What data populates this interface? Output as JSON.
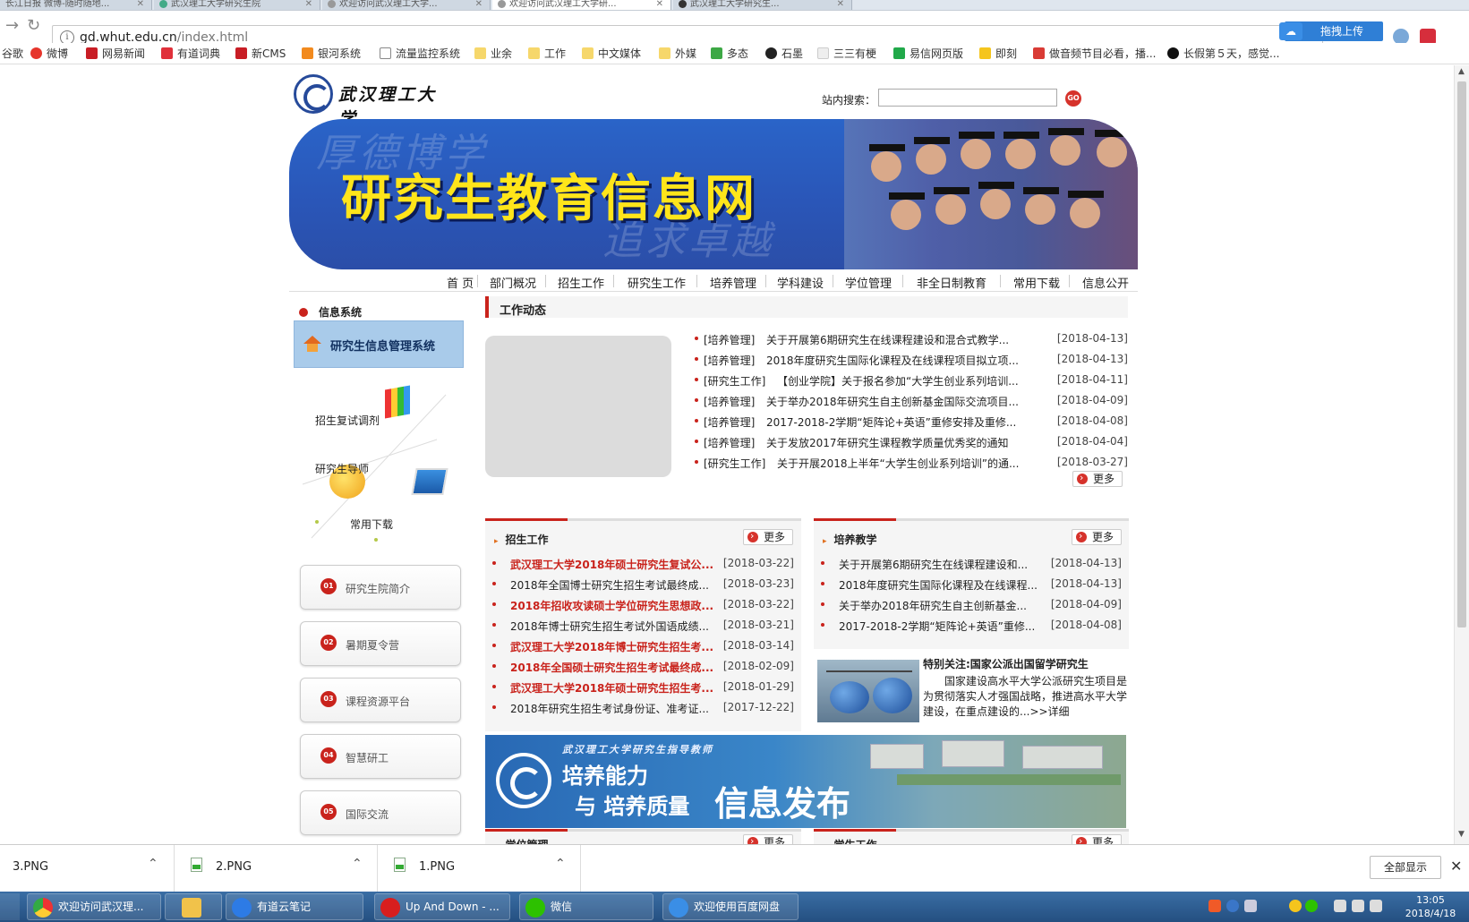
{
  "browser": {
    "tabs": [
      {
        "label": "长江日报 微博-随时随地..."
      },
      {
        "label": "武汉理工大学研究生院"
      },
      {
        "label": "欢迎访问武汉理工大学..."
      },
      {
        "label": "欢迎访问武汉理工大学研..."
      },
      {
        "label": "武汉理工大学研究生..."
      }
    ],
    "url_host": "gd.whut.edu.cn",
    "url_path": "/index.html",
    "baidu_upload_label": "拖拽上传",
    "bookmarks": [
      "谷歌",
      "微博",
      "网易新闻",
      "有道词典",
      "新CMS",
      "银河系统",
      "流量监控系统",
      "业余",
      "工作",
      "中文媒体",
      "外媒",
      "多态",
      "石墨",
      "三三有梗",
      "易信网页版",
      "即刻",
      "做音频节目必看，播...",
      "长假第５天，感觉..."
    ]
  },
  "site": {
    "logo_text": "武汉理工大学",
    "search_label": "站内搜索：",
    "search_value": "",
    "search_go": "GO",
    "banner_title": "研究生教育信息网",
    "banner_motto_1": "厚德博学",
    "banner_motto_2": "追求卓越",
    "nav": [
      "首 页",
      "部门概况",
      "招生工作",
      "研究生工作",
      "培养管理",
      "学科建设",
      "学位管理",
      "非全日制教育",
      "常用下载",
      "信息公开"
    ]
  },
  "left": {
    "info_header": "信息系统",
    "system_link": "研究生信息管理系统",
    "quick_links": [
      "招生复试调剂",
      "研究生导师",
      "常用下载"
    ],
    "numbered": [
      {
        "num": "01",
        "label": "研究生院简介"
      },
      {
        "num": "02",
        "label": "暑期夏令营"
      },
      {
        "num": "03",
        "label": "课程资源平台"
      },
      {
        "num": "04",
        "label": "智慧研工"
      },
      {
        "num": "05",
        "label": "国际交流"
      }
    ]
  },
  "work": {
    "header": "工作动态",
    "more": "更多",
    "items": [
      {
        "cat": "[培养管理]",
        "title": "关于开展第6期研究生在线课程建设和混合式教学...",
        "date": "[2018-04-13]"
      },
      {
        "cat": "[培养管理]",
        "title": "2018年度研究生国际化课程及在线课程项目拟立项...",
        "date": "[2018-04-13]"
      },
      {
        "cat": "[研究生工作]",
        "title": "【创业学院】关于报名参加“大学生创业系列培训...",
        "date": "[2018-04-11]"
      },
      {
        "cat": "[培养管理]",
        "title": "关于举办2018年研究生自主创新基金国际交流项目...",
        "date": "[2018-04-09]"
      },
      {
        "cat": "[培养管理]",
        "title": "2017-2018-2学期“矩阵论+英语”重修安排及重修...",
        "date": "[2018-04-08]"
      },
      {
        "cat": "[培养管理]",
        "title": "关于发放2017年研究生课程教学质量优秀奖的通知",
        "date": "[2018-04-04]"
      },
      {
        "cat": "[研究生工作]",
        "title": "关于开展2018上半年“大学生创业系列培训”的通...",
        "date": "[2018-03-27]"
      }
    ]
  },
  "admissions": {
    "header": "招生工作",
    "more": "更多",
    "items": [
      {
        "title": "武汉理工大学2018年硕士研究生复试公...",
        "date": "[2018-03-22]",
        "red": true
      },
      {
        "title": "2018年全国博士研究生招生考试最终成...",
        "date": "[2018-03-23]",
        "red": false
      },
      {
        "title": "2018年招收攻读硕士学位研究生思想政...",
        "date": "[2018-03-22]",
        "red": true
      },
      {
        "title": "2018年博士研究生招生考试外国语成绩...",
        "date": "[2018-03-21]",
        "red": false
      },
      {
        "title": "武汉理工大学2018年博士研究生招生考...",
        "date": "[2018-03-14]",
        "red": true
      },
      {
        "title": "2018年全国硕士研究生招生考试最终成...",
        "date": "[2018-02-09]",
        "red": true
      },
      {
        "title": "武汉理工大学2018年硕士研究生招生考...",
        "date": "[2018-01-29]",
        "red": true
      },
      {
        "title": "2018年研究生招生考试身份证、准考证...",
        "date": "[2017-12-22]",
        "red": false
      }
    ]
  },
  "teaching": {
    "header": "培养教学",
    "more": "更多",
    "items": [
      {
        "title": "关于开展第6期研究生在线课程建设和...",
        "date": "[2018-04-13]"
      },
      {
        "title": "2018年度研究生国际化课程及在线课程...",
        "date": "[2018-04-13]"
      },
      {
        "title": "关于举办2018年研究生自主创新基金...",
        "date": "[2018-04-09]"
      },
      {
        "title": "2017-2018-2学期“矩阵论+英语”重修...",
        "date": "[2018-04-08]"
      }
    ]
  },
  "special": {
    "title": "特别关注:国家公派出国留学研究生",
    "text": "国家建设高水平大学公派研究生项目是为贯彻落实人才强国战略，推进高水平大学建设，在重点建设的...>>详细"
  },
  "campus_banner": {
    "slogan": "武汉理工大学研究生指导教师",
    "line1": "培养能力",
    "line2": "与 培养质量",
    "line3": "信息发布"
  },
  "lower_panels": [
    {
      "header": "学位管理",
      "more": "更多"
    },
    {
      "header": "学生工作",
      "more": "更多"
    }
  ],
  "downloads": {
    "files": [
      "3.PNG",
      "2.PNG",
      "1.PNG"
    ],
    "show_all": "全部显示"
  },
  "taskbar": {
    "items": [
      "欢迎访问武汉理...",
      "",
      "有道云笔记",
      "Up And Down - ...",
      "微信",
      "欢迎使用百度网盘"
    ],
    "time": "13:05",
    "date": "2018/4/18"
  }
}
